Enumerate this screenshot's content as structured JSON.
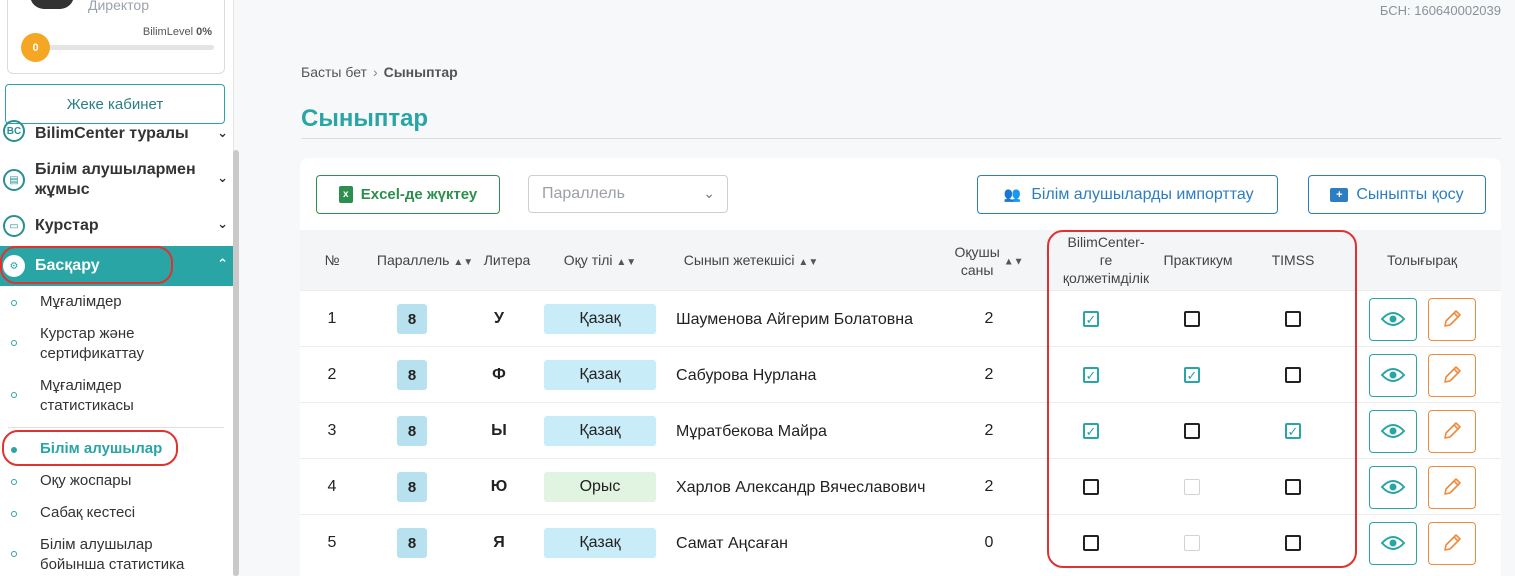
{
  "user": {
    "role": "Директор",
    "level_label": "BilimLevel",
    "level_percent": "0%",
    "level_value": "0"
  },
  "sidebar": {
    "cabinet_button": "Жеке кабинет",
    "menu": [
      {
        "label": "BilimCenter туралы"
      },
      {
        "label": "Білім алушылармен жұмыс"
      },
      {
        "label": "Курстар"
      },
      {
        "label": "Басқару"
      }
    ],
    "submenu": [
      {
        "label": "Мұғалімдер"
      },
      {
        "label": "Курстар және сертификаттау"
      },
      {
        "label": "Мұғалімдер статистикасы"
      },
      {
        "label": "Білім алушылар"
      },
      {
        "label": "Оқу жоспары"
      },
      {
        "label": "Сабақ кестесі"
      },
      {
        "label": "Білім алушылар бойынша статистика"
      }
    ]
  },
  "header": {
    "bsn": "БСН: 160640002039"
  },
  "breadcrumb": {
    "home": "Басты бет",
    "current": "Сыныптар"
  },
  "page": {
    "title": "Сыныптар"
  },
  "toolbar": {
    "excel_label": "Excel-де жүктеу",
    "parallel_placeholder": "Параллель",
    "import_label": "Білім алушыларды импорттау",
    "add_class_label": "Сыныпты қосу"
  },
  "table": {
    "headers": {
      "num": "№",
      "parallel": "Параллель",
      "litera": "Литера",
      "language": "Оқу тілі",
      "teacher": "Сынып жетекшісі",
      "students_line1": "Оқушы",
      "students_line2": "саны",
      "access_line1": "BilimCenter-",
      "access_line2": "ге",
      "access_line3": "қолжетімділік",
      "practicum": "Практикум",
      "timss": "TIMSS",
      "more": "Толығырақ"
    },
    "rows": [
      {
        "num": "1",
        "parallel": "8",
        "litera": "У",
        "language": "Қазақ",
        "teacher": "Шауменова Айгерим Болатовна",
        "students": "2",
        "access": "checked",
        "practicum": "unchecked",
        "timss": "unchecked"
      },
      {
        "num": "2",
        "parallel": "8",
        "litera": "Ф",
        "language": "Қазақ",
        "teacher": "Сабурова Нурлана",
        "students": "2",
        "access": "checked",
        "practicum": "checked",
        "timss": "unchecked"
      },
      {
        "num": "3",
        "parallel": "8",
        "litera": "Ы",
        "language": "Қазақ",
        "teacher": "Мұратбекова Майра",
        "students": "2",
        "access": "checked",
        "practicum": "unchecked",
        "timss": "checked"
      },
      {
        "num": "4",
        "parallel": "8",
        "litera": "Ю",
        "language": "Орыс",
        "teacher": "Харлов Александр Вячеславович",
        "students": "2",
        "access": "unchecked",
        "practicum": "disabled",
        "timss": "unchecked"
      },
      {
        "num": "5",
        "parallel": "8",
        "litera": "Я",
        "language": "Қазақ",
        "teacher": "Самат Аңсаған",
        "students": "0",
        "access": "unchecked",
        "practicum": "disabled",
        "timss": "unchecked"
      }
    ]
  },
  "colors": {
    "accent": "#2aa5a6",
    "excel": "#2d8f4e",
    "primary_blue": "#2d7dc1",
    "edit_orange": "#f08a3c",
    "highlight_red": "#e0322f"
  }
}
